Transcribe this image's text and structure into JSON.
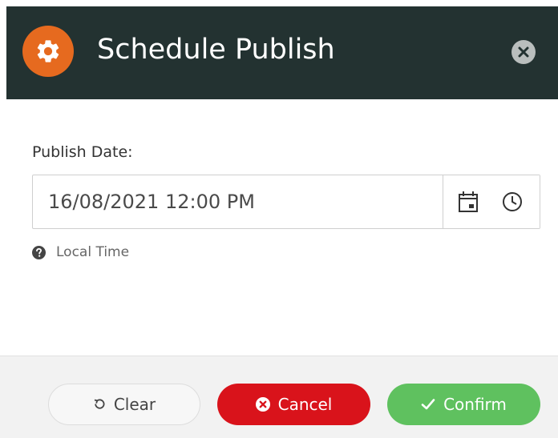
{
  "dialog": {
    "title": "Schedule Publish",
    "header_icon": "gear-icon",
    "close_icon": "close-icon"
  },
  "form": {
    "publish_date_label": "Publish Date:",
    "publish_date_value": "16/08/2021 12:00 PM",
    "calendar_icon": "calendar-icon",
    "clock_icon": "clock-icon",
    "hint_icon": "question-circle-icon",
    "hint_text": "Local Time"
  },
  "actions": {
    "clear_label": "Clear",
    "cancel_label": "Cancel",
    "confirm_label": "Confirm"
  },
  "colors": {
    "header_bg": "#233231",
    "header_icon_bg": "#e66a1f",
    "cancel_bg": "#d9131b",
    "confirm_bg": "#5fc15f",
    "footer_bg": "#f2f2f2"
  }
}
